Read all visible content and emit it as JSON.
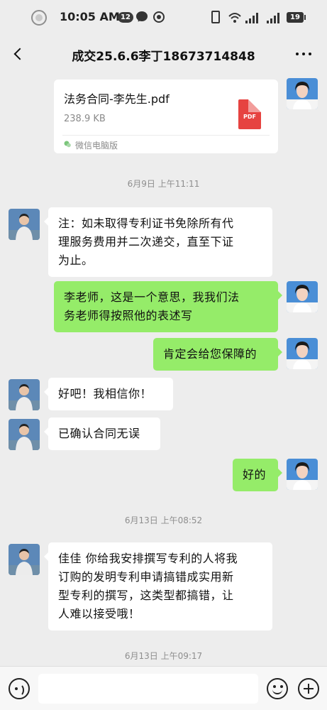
{
  "status_bar": {
    "time": "10:05 AM",
    "notification_count": "12",
    "battery": "19"
  },
  "nav": {
    "title": "成交25.6.6李丁18673714848"
  },
  "file_message": {
    "name": "法务合同-李先生.pdf",
    "size": "238.9 KB",
    "type_label": "PDF",
    "source": "微信电脑版"
  },
  "messages": [
    {
      "kind": "time",
      "text": "6月9日 上午11:11"
    },
    {
      "kind": "left",
      "lines": [
        "注：如未取得专利证书免除所有代",
        "理服务费用并二次递交，直至下证",
        "为止。"
      ]
    },
    {
      "kind": "right",
      "lines": [
        "李老师，这是一个意思，我我们法",
        "务老师得按照他的表述写"
      ]
    },
    {
      "kind": "right",
      "lines": [
        "肯定会给您保障的"
      ]
    },
    {
      "kind": "left",
      "lines": [
        "好吧！我相信你！"
      ]
    },
    {
      "kind": "left",
      "lines": [
        "已确认合同无误"
      ]
    },
    {
      "kind": "right",
      "lines": [
        "好的"
      ]
    },
    {
      "kind": "time",
      "text": "6月13日 上午08:52"
    },
    {
      "kind": "left",
      "lines": [
        "佳佳 你给我安排撰写专利的人将我",
        "订购的发明专利申请搞错成实用新",
        "型专利的撰写，这类型都搞错，让",
        "人难以接受哦！"
      ]
    },
    {
      "kind": "time",
      "text": "6月13日 上午09:17"
    }
  ],
  "input": {
    "placeholder": ""
  },
  "icons": {
    "back": "back-arrow-icon",
    "more": "more-dots-icon",
    "voice": "voice-icon",
    "emoji": "emoji-icon",
    "plus": "plus-icon"
  },
  "colors": {
    "sent_bubble": "#95ec69",
    "received_bubble": "#ffffff",
    "background": "#ededed"
  }
}
